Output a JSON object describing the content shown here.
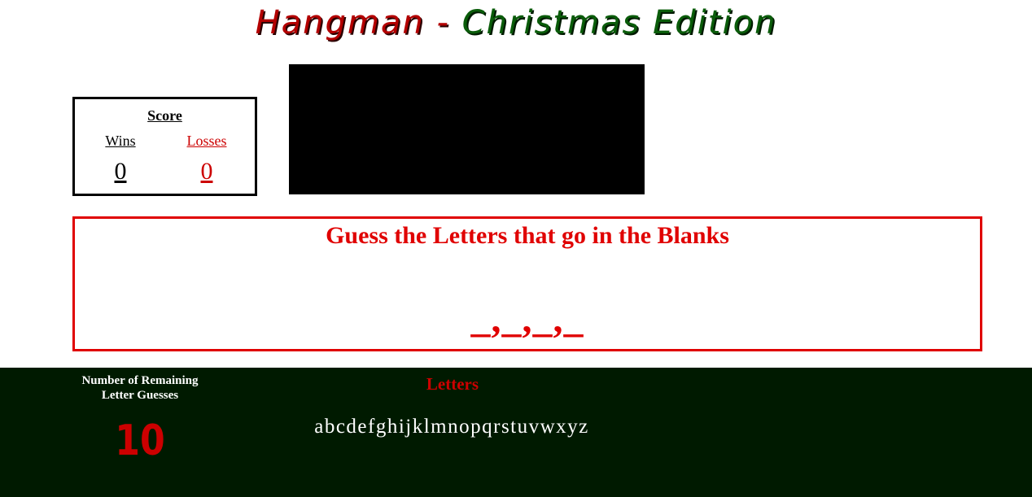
{
  "header": {
    "title_part1": "Hangman",
    "title_separator": " - ",
    "title_part2": "Christmas Edition"
  },
  "score": {
    "heading": "Score",
    "wins_label": "Wins",
    "wins_value": "0",
    "losses_label": "Losses",
    "losses_value": "0"
  },
  "guess": {
    "heading": "Guess the Letters that go in the Blanks",
    "blanks": "_,_,_,_"
  },
  "bottom": {
    "remaining_label": "Number of Remaining Letter Guesses",
    "remaining_count": "10",
    "letters_heading": "Letters",
    "letters_list": "abcdefghijklmnopqrstuvwxyz"
  },
  "colors": {
    "accent_red": "#e00000",
    "accent_green": "#0a5c0a",
    "panel_background": "#001a00"
  }
}
